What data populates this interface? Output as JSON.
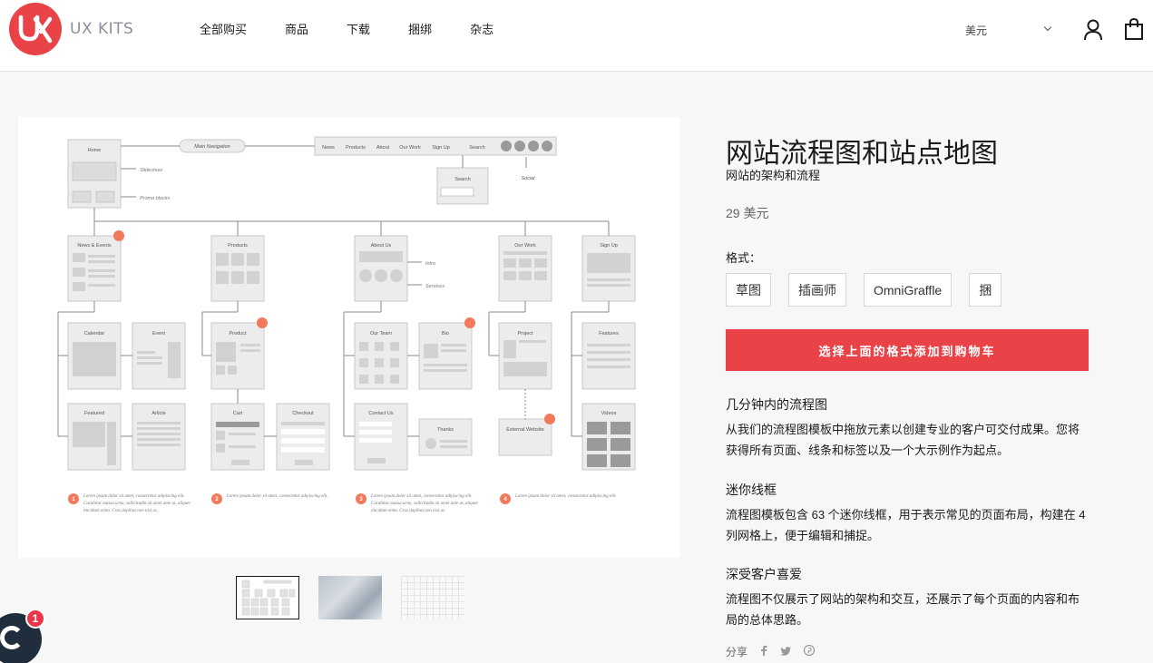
{
  "header": {
    "logo_text": "UX KITS",
    "nav": [
      "全部购买",
      "商品",
      "下载",
      "捆绑",
      "杂志"
    ],
    "currency": "美元"
  },
  "product": {
    "title": "网站流程图和站点地图",
    "subtitle": "网站的架构和流程",
    "price": "29 美元",
    "format_label": "格式：",
    "formats": [
      "草图",
      "插画师",
      "OmniGraffle",
      "捆"
    ],
    "add_to_cart": "选择上面的格式添加到购物车",
    "features": [
      {
        "title": "几分钟内的流程图",
        "text": "从我们的流程图模板中拖放元素以创建专业的客户可交付成果。您将获得所有页面、线条和标签以及一个大示例作为起点。"
      },
      {
        "title": "迷你线框",
        "text": "流程图模板包含 63 个迷你线框，用于表示常见的页面布局，构建在 4 列网格上，便于编辑和捕捉。"
      },
      {
        "title": "深受客户喜爱",
        "text": "流程图不仅展示了网站的架构和交互，还展示了每个页面的内容和布局的总体思路。"
      }
    ],
    "share_label": "分享"
  },
  "wireframe": {
    "main_nav_label": "Main Navigation",
    "nav_items": [
      "News",
      "Products",
      "About",
      "Our Work",
      "Sign Up",
      "Search"
    ],
    "search_label": "Search",
    "social_label": "Social",
    "home_label": "Home",
    "slideshow_label": "Slideshow",
    "promo_label": "Promo blocks",
    "row1": [
      "News & Events",
      "Products",
      "About Us",
      "Our Work",
      "Sign Up"
    ],
    "intro_label": "Intro",
    "services_label": "Services",
    "row2": [
      "Calendar",
      "Event",
      "Product",
      "Our Team",
      "Bio",
      "Project",
      "Features"
    ],
    "row3": [
      "Featured",
      "Article",
      "Cart",
      "Checkout",
      "Contact Us",
      "Thanks",
      "External Website",
      "Videos"
    ],
    "badges": [
      "1",
      "2",
      "3",
      "4"
    ],
    "notes": [
      "Lorem ipsum dolor sit amet, consectetur adipiscing elit. Curabitur massa urna, sollicitudin sit amet ante at, aliquet tincidunt enim. Cras dapibus non nisi ac.",
      "Lorem ipsum dolor sit amet, consectetur adipiscing elit.",
      "Lorem ipsum dolor sit amet, consectetur adipiscing elit. Curabitur massa urna, sollicitudin sit amet ante at, aliquet tincidunt enim. Cras dapibus non nisi ac.",
      "Lorem ipsum dolor sit amet, consectetur adipiscing elit."
    ]
  },
  "chat": {
    "badge": "1"
  },
  "colors": {
    "accent": "#e94348",
    "text": "#1c1b1b",
    "chat": "#1f2d3d"
  }
}
